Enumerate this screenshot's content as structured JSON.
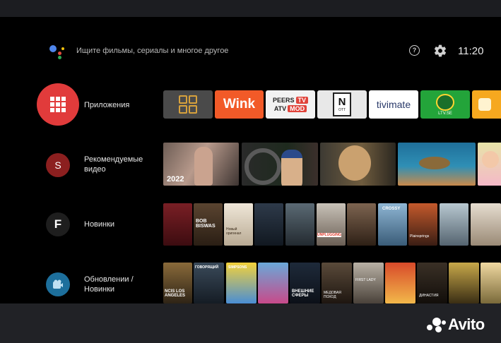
{
  "search": {
    "placeholder_text": "Ищите фильмы, сериалы и многое другое"
  },
  "status": {
    "time": "11:20",
    "help_symbol": "?"
  },
  "rows": [
    {
      "icon_letter": "",
      "label": "Приложения"
    },
    {
      "icon_letter": "S",
      "label": "Рекомендуемые видео"
    },
    {
      "icon_letter": "F",
      "label": "Новинки"
    },
    {
      "icon_letter": "",
      "label": "Обновлении / Новинки"
    }
  ],
  "apps": [
    {
      "name": "all-apps-grid",
      "label": ""
    },
    {
      "name": "wink",
      "label": "Wink"
    },
    {
      "name": "peers-tv-atv-mod",
      "label_top": "PEERS",
      "label_tv": "TV",
      "label_bottom": "ATV",
      "label_mod": "MOD"
    },
    {
      "name": "n-ott",
      "label": "N",
      "sublabel": "OTT"
    },
    {
      "name": "tivimate",
      "label": "tivimate"
    },
    {
      "name": "ltv",
      "label": "LTV.SE"
    }
  ],
  "videos": [
    {
      "caption": "2022"
    }
  ],
  "posters_row3": [
    {
      "title": ""
    },
    {
      "title": "BOB BISWAS"
    },
    {
      "title": "Новый оригинал"
    },
    {
      "title": ""
    },
    {
      "title": ""
    },
    {
      "title": "UNPLUGGING"
    },
    {
      "title": ""
    },
    {
      "title": "CROSSY"
    },
    {
      "title": "Plainsprings"
    },
    {
      "title": ""
    },
    {
      "title": ""
    }
  ],
  "posters_row4": [
    {
      "title": "NCIS LOS ANGELES"
    },
    {
      "title": "ГОВОРЯЩИЙ"
    },
    {
      "title": "SIMPSONS"
    },
    {
      "title": ""
    },
    {
      "title": "ВНЕШНИЕ СФЕРЫ"
    },
    {
      "title": "МЕДОВАЯ ПОХОД"
    },
    {
      "title": "FIRST LADY"
    },
    {
      "title": ""
    },
    {
      "title": "ДИНАСТИЯ"
    },
    {
      "title": ""
    },
    {
      "title": ""
    }
  ],
  "watermark": {
    "text": "Avito"
  }
}
